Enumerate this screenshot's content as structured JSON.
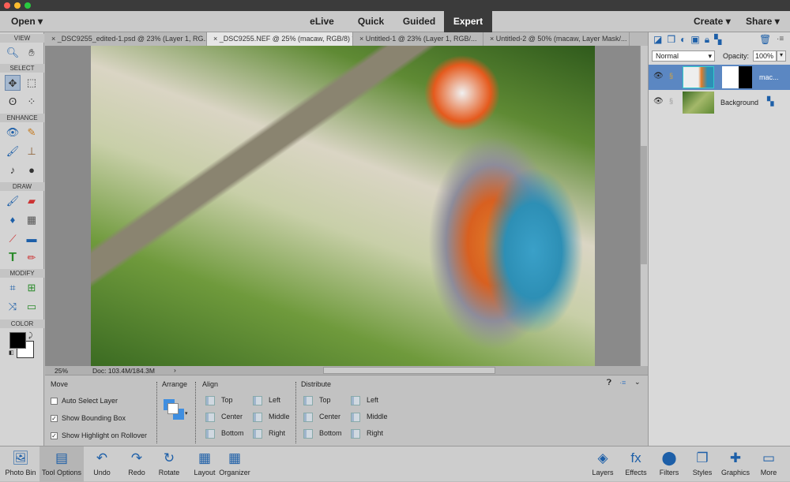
{
  "menubar": {
    "open": "Open",
    "modes": [
      "eLive",
      "Quick",
      "Guided",
      "Expert"
    ],
    "active_mode": "Expert",
    "create": "Create",
    "share": "Share"
  },
  "tabs": [
    {
      "label": "_DSC9255_edited-1.psd @ 23% (Layer 1, RG..."
    },
    {
      "label": "_DSC9255.NEF @ 25% (macaw, RGB/8) *",
      "active": true
    },
    {
      "label": "Untitled-1 @ 23% (Layer 1, RGB/..."
    },
    {
      "label": "Untitled-2 @ 50% (macaw, Layer Mask/..."
    }
  ],
  "toolbar": {
    "sections": [
      "VIEW",
      "SELECT",
      "ENHANCE",
      "DRAW",
      "MODIFY",
      "COLOR"
    ],
    "colors": {
      "foreground": "#000000",
      "background": "#ffffff"
    }
  },
  "status": {
    "zoom": "25%",
    "doc": "Doc: 103.4M/184.3M"
  },
  "tool_options": {
    "move": {
      "title": "Move",
      "auto_select": "Auto Select Layer",
      "auto_select_checked": false,
      "bounding": "Show Bounding Box",
      "bounding_checked": true,
      "highlight": "Show Highlight on Rollover",
      "highlight_checked": true
    },
    "arrange": "Arrange",
    "align": {
      "title": "Align",
      "items": [
        "Top",
        "Center",
        "Bottom",
        "Left",
        "Middle",
        "Right"
      ]
    },
    "distribute": {
      "title": "Distribute",
      "items": [
        "Top",
        "Center",
        "Bottom",
        "Left",
        "Middle",
        "Right"
      ]
    }
  },
  "layers": {
    "blend_mode": "Normal",
    "opacity_label": "Opacity:",
    "opacity": "100%",
    "items": [
      {
        "name": "mac...",
        "selected": true
      },
      {
        "name": "Background",
        "selected": false
      }
    ]
  },
  "bottombar": {
    "left": [
      "Photo Bin",
      "Tool Options",
      "Undo",
      "Redo",
      "Rotate",
      "Layout",
      "Organizer"
    ],
    "right": [
      "Layers",
      "Effects",
      "Filters",
      "Styles",
      "Graphics",
      "More"
    ]
  },
  "accent": "#4f7fb8"
}
